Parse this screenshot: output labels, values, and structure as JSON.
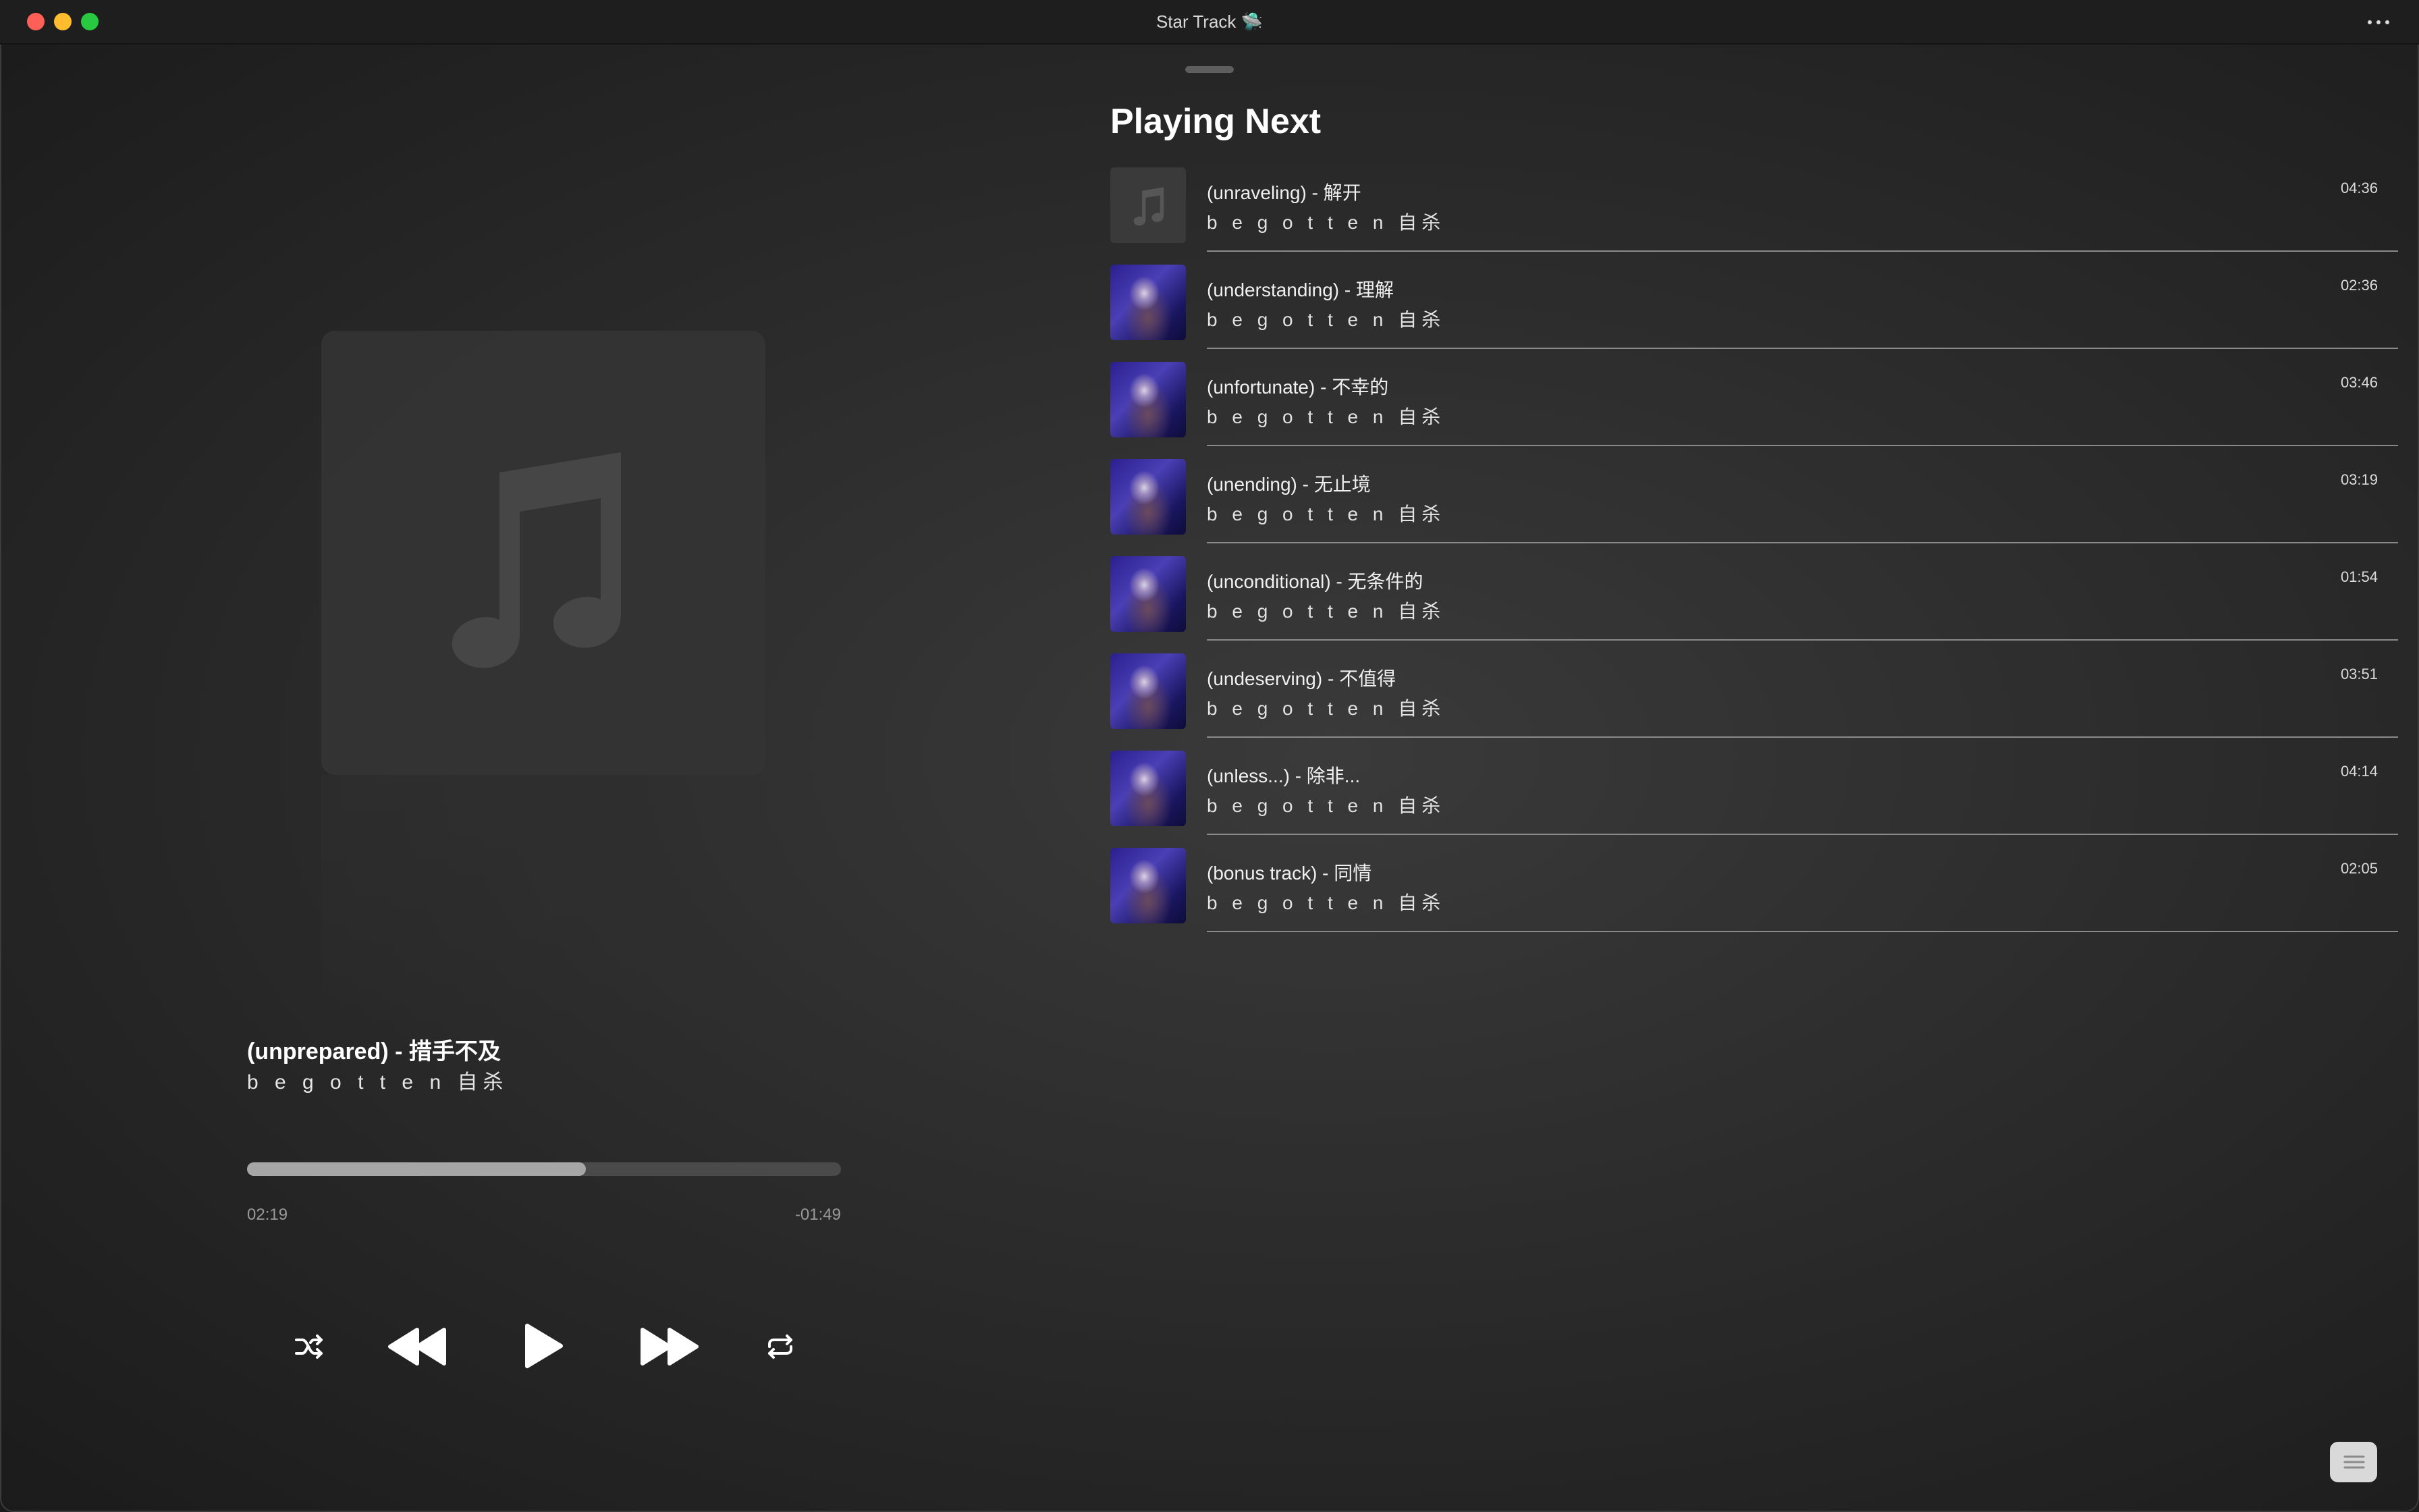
{
  "window": {
    "title": "Star Track 🛸"
  },
  "now_playing": {
    "title": "(unprepared) - 措手不及",
    "artist": "b e g o t t e n 自杀",
    "elapsed": "02:19",
    "remaining": "-01:49",
    "progress_fraction": 0.571
  },
  "controls": {
    "icons": [
      "shuffle-icon",
      "rewind-icon",
      "play-icon",
      "fast-forward-icon",
      "repeat-icon"
    ]
  },
  "queue": {
    "heading": "Playing Next",
    "tracks": [
      {
        "title": "(unraveling) - 解开",
        "artist": "b e g o t t e n 自杀",
        "duration": "04:36",
        "art": "placeholder"
      },
      {
        "title": "(understanding) - 理解",
        "artist": "b e g o t t e n 自杀",
        "duration": "02:36",
        "art": "cover"
      },
      {
        "title": "(unfortunate) - 不幸的",
        "artist": "b e g o t t e n 自杀",
        "duration": "03:46",
        "art": "cover"
      },
      {
        "title": "(unending) - 无止境",
        "artist": "b e g o t t e n 自杀",
        "duration": "03:19",
        "art": "cover"
      },
      {
        "title": "(unconditional) - 无条件的",
        "artist": "b e g o t t e n 自杀",
        "duration": "01:54",
        "art": "cover"
      },
      {
        "title": "(undeserving) - 不值得",
        "artist": "b e g o t t e n 自杀",
        "duration": "03:51",
        "art": "cover"
      },
      {
        "title": "(unless...) - 除非...",
        "artist": "b e g o t t e n 自杀",
        "duration": "04:14",
        "art": "cover"
      },
      {
        "title": "(bonus track) - 同情",
        "artist": "b e g o t t e n 自杀",
        "duration": "02:05",
        "art": "cover"
      }
    ]
  },
  "colors": {
    "close": "#fe5f57",
    "minimize": "#febc2e",
    "maximize": "#28c840",
    "progress_fill": "#a6a6a6",
    "progress_track": "#4a4a4a"
  }
}
